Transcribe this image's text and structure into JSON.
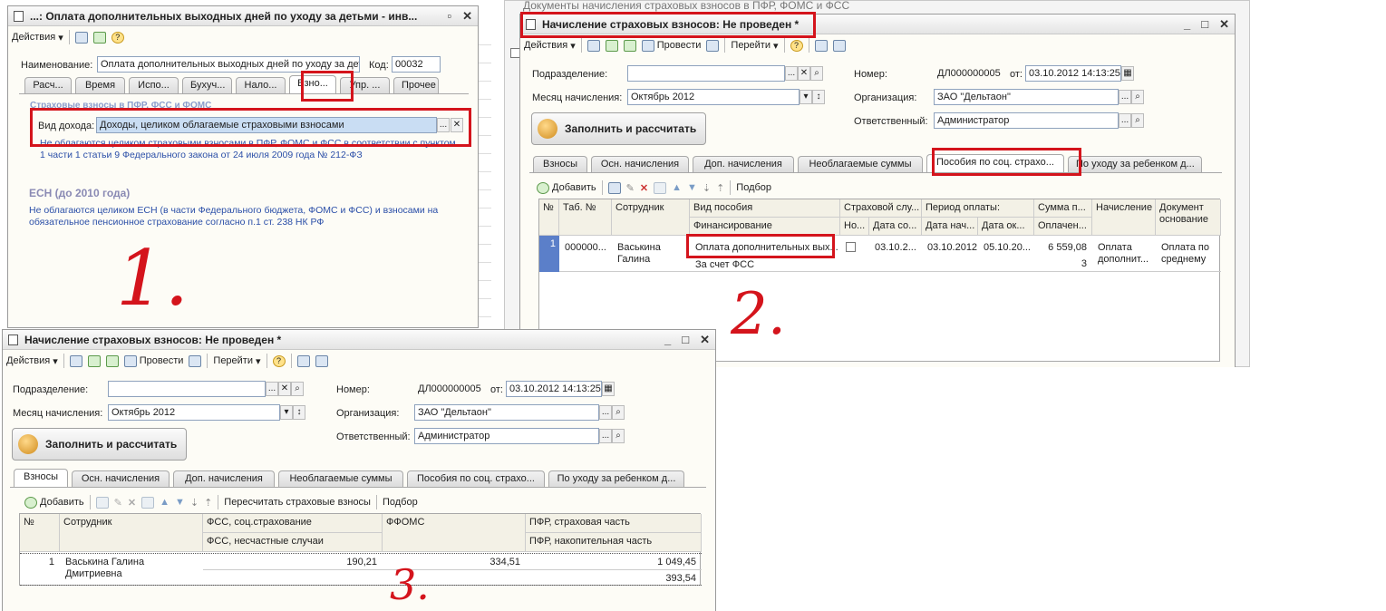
{
  "background_title": "Документы начисления страховых взносов в ПФР, ФОМС и ФСС",
  "w1": {
    "title": "...: Оплата дополнительных выходных дней по уходу за детьми - инв...",
    "actions": "Действия",
    "name_label": "Наименование:",
    "name_value": "Оплата дополнительных выходных дней по уходу за дет",
    "code_label": "Код:",
    "code_value": "00032",
    "tabs": [
      "Расч...",
      "Время",
      "Испо...",
      "Бухуч...",
      "Нало...",
      "Взно...",
      "Упр. ...",
      "Прочее"
    ],
    "section_title": "Страховые взносы в ПФР, ФСС и ФОМС",
    "income_label": "Вид дохода:",
    "income_value": "Доходы, целиком облагаемые страховыми взносами",
    "note1": "Не облагаются целиком страховыми взносами в ПФР, ФОМС и ФСС в соответствии с пунктом 1 части 1 статьи 9 Федерального закона от 24 июля 2009 года № 212-ФЗ",
    "esn_title": "ЕСН (до 2010 года)",
    "note2": "Не облагаются целиком ЕСН (в части Федерального бюджета, ФОМС и ФСС) и взносами на обязательное пенсионное страхование согласно п.1 ст. 238 НК РФ"
  },
  "w2": {
    "title": "Начисление страховых взносов: Не проведен *",
    "toolbar": {
      "actions": "Действия",
      "post": "Провести",
      "goto": "Перейти"
    },
    "dept_label": "Подразделение:",
    "month_label": "Месяц начисления:",
    "month_value": "Октябрь 2012",
    "number_label": "Номер:",
    "number_value": "ДЛ000000005",
    "from_label": "от:",
    "date_value": "03.10.2012 14:13:25",
    "org_label": "Организация:",
    "org_value": "ЗАО \"Дельтаон\"",
    "resp_label": "Ответственный:",
    "resp_value": "Администратор",
    "fill_button": "Заполнить и рассчитать",
    "tabs": [
      "Взносы",
      "Осн. начисления",
      "Доп. начисления",
      "Необлагаемые суммы",
      "Пособия по соц. страхо...",
      "По уходу за ребенком д..."
    ],
    "add": "Добавить",
    "pick": "Подбор",
    "cols": {
      "n": "№",
      "tab": "Таб. №",
      "emp": "Сотрудник",
      "benefit": "Вид пособия",
      "financing": "Финансирование",
      "ins_case": "Страховой слу...",
      "no": "Но...",
      "date_co": "Дата со...",
      "period": "Период оплаты:",
      "date_start": "Дата нач...",
      "date_end": "Дата ок...",
      "sum": "Сумма п...",
      "paid": "Оплачен...",
      "accrual": "Начисление",
      "doc": "Документ основание"
    },
    "row": {
      "n": "1",
      "tab": "000000...",
      "emp": "Васькина Галина",
      "benefit": "Оплата дополнительных вых...",
      "financing": "За счет ФСС",
      "date_co": "03.10.2...",
      "date_start": "03.10.2012",
      "date_end": "05.10.20...",
      "sum": "6 559,08",
      "paid": "3",
      "accrual": "Оплата дополнит...",
      "doc": "Оплата по среднему"
    }
  },
  "w3": {
    "title": "Начисление страховых взносов: Не проведен *",
    "toolbar": {
      "actions": "Действия",
      "post": "Провести",
      "goto": "Перейти"
    },
    "dept_label": "Подразделение:",
    "month_label": "Месяц начисления:",
    "month_value": "Октябрь 2012",
    "number_label": "Номер:",
    "number_value": "ДЛ000000005",
    "from_label": "от:",
    "date_value": "03.10.2012 14:13:25",
    "org_label": "Организация:",
    "org_value": "ЗАО \"Дельтаон\"",
    "resp_label": "Ответственный:",
    "resp_value": "Администратор",
    "fill_button": "Заполнить и рассчитать",
    "tabs": [
      "Взносы",
      "Осн. начисления",
      "Доп. начисления",
      "Необлагаемые суммы",
      "Пособия по соц. страхо...",
      "По уходу за ребенком д..."
    ],
    "add": "Добавить",
    "recalc": "Пересчитать страховые взносы",
    "pick": "Подбор",
    "cols": {
      "n": "№",
      "emp": "Сотрудник",
      "fss": "ФСС, соц.страхование",
      "fss_acc": "ФСС, несчастные случаи",
      "ffoms": "ФФОМС",
      "pfr_ins": "ПФР, страховая часть",
      "pfr_acc": "ПФР, накопительная часть"
    },
    "row": {
      "n": "1",
      "emp": "Васькина Галина Дмитриевна",
      "fss": "190,21",
      "ffoms": "334,51",
      "pfr_ins": "1 049,45",
      "pfr_acc": "393,54"
    }
  },
  "annotations": {
    "a1": "1.",
    "a2": "2.",
    "a3": "3."
  }
}
